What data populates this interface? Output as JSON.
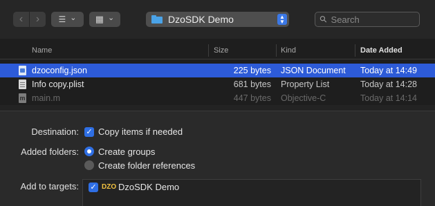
{
  "toolbar": {
    "back_glyph": "‹",
    "forward_glyph": "›",
    "list_view_glyph": "☰",
    "grid_view_glyph": "▦",
    "dropdown_glyph": "⌄",
    "path_label": "DzoSDK Demo",
    "search_placeholder": "Search",
    "search_glyph": "⚲"
  },
  "columns": {
    "name": "Name",
    "size": "Size",
    "kind": "Kind",
    "date_added": "Date Added"
  },
  "files": [
    {
      "name": "dzoconfig.json",
      "size": "225 bytes",
      "kind": "JSON Document",
      "date": "Today at 14:49",
      "icon": "json-file-icon"
    },
    {
      "name": "Info copy.plist",
      "size": "681 bytes",
      "kind": "Property List",
      "date": "Today at 14:28",
      "icon": "plist-file-icon"
    },
    {
      "name": "main.m",
      "size": "447 bytes",
      "kind": "Objective-C",
      "date": "Today at 14:14",
      "icon": "objc-file-icon",
      "m_glyph": "m"
    }
  ],
  "options": {
    "destination_label": "Destination:",
    "copy_items": "Copy items if needed",
    "added_folders_label": "Added folders:",
    "create_groups": "Create groups",
    "create_folder_refs": "Create folder references",
    "add_to_targets_label": "Add to targets:",
    "target_name": "DzoSDK Demo",
    "target_icon_text": "DZO",
    "check_glyph": "✓"
  },
  "colors": {
    "selection": "#2d5bd8",
    "accent": "#2f6fe4",
    "folder": "#4aa3e8"
  }
}
